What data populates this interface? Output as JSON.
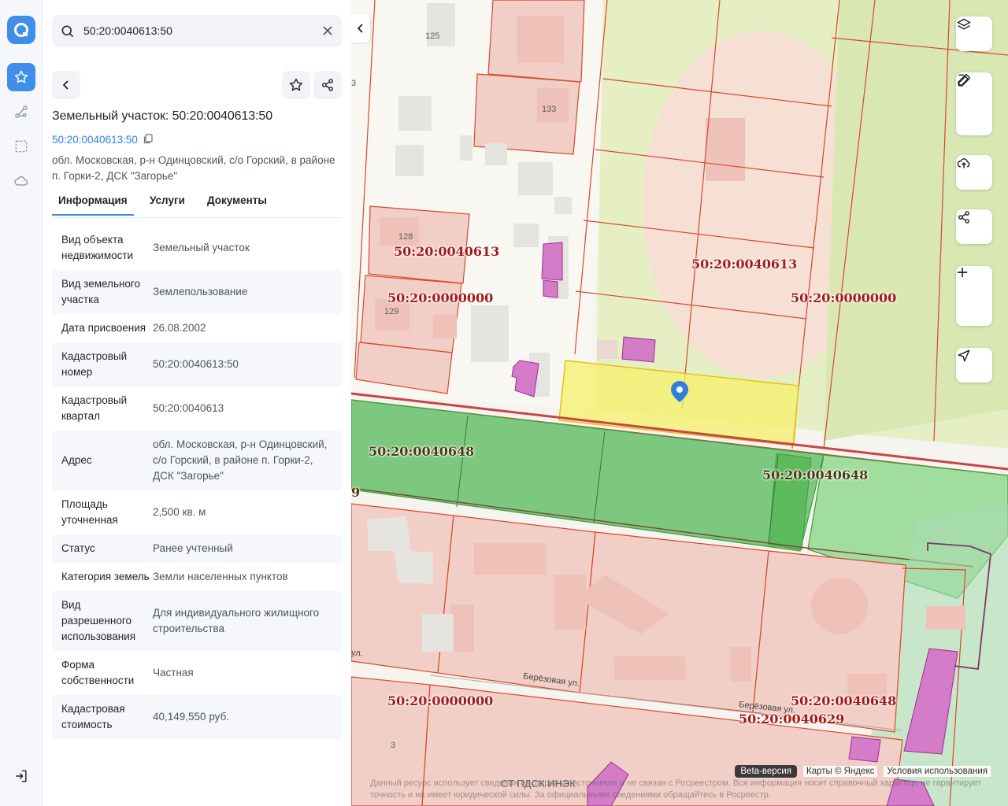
{
  "search": {
    "value": "50:20:0040613:50"
  },
  "panel": {
    "title": "Земельный участок: 50:20:0040613:50",
    "cad_link": "50:20:0040613:50",
    "address": "обл. Московская, р-н Одинцовский, с/о Горский, в районе п. Горки-2, ДСК \"Загорье\""
  },
  "tabs": [
    {
      "label": "Информация"
    },
    {
      "label": "Услуги"
    },
    {
      "label": "Документы"
    }
  ],
  "info": [
    {
      "k": "Вид объекта недвижимости",
      "v": "Земельный участок"
    },
    {
      "k": "Вид земельного участка",
      "v": "Землепользование"
    },
    {
      "k": "Дата присвоения",
      "v": "26.08.2002"
    },
    {
      "k": "Кадастровый номер",
      "v": "50:20:0040613:50"
    },
    {
      "k": "Кадастровый квартал",
      "v": "50:20:0040613"
    },
    {
      "k": "Адрес",
      "v": "обл. Московская, р-н Одинцовский, с/о Горский, в районе п. Горки-2, ДСК \"Загорье\""
    },
    {
      "k": "Площадь уточненная",
      "v": "2,500 кв. м"
    },
    {
      "k": "Статус",
      "v": "Ранее учтенный"
    },
    {
      "k": "Категория земель",
      "v": "Земли населенных пунктов"
    },
    {
      "k": "Вид разрешенного использования",
      "v": "Для индивидуального жилищного строительства"
    },
    {
      "k": "Форма собственности",
      "v": "Частная"
    },
    {
      "k": "Кадастровая стоимость",
      "v": "40,149,550 руб."
    }
  ],
  "map": {
    "labels": {
      "l1": "50:20:0040613",
      "l2": "50:20:0000000",
      "l3": "50:20:0040613",
      "l4": "50:20:0000000",
      "l5": "50:20:0040648",
      "l6": "50:20:0040648",
      "l7": "50:20:0000000",
      "l8": "50:20:0040648",
      "l9": "50:20:0040629",
      "l10": "9"
    },
    "houses": {
      "h125": "125",
      "h133": "133",
      "h128": "128",
      "h129": "129",
      "h3a": "3",
      "h3b": "3"
    },
    "streets": {
      "s1": "Берёзовая ул.",
      "s2": "Берёзовая ул.",
      "s3": "ул.",
      "s4": "СТ ПДСК ИНЭК"
    },
    "beta": "Beta-версия",
    "attribution": "Карты © Яндекс",
    "terms": "Условия использования",
    "disclaimer": "Данный ресурс использует сведения из открытых источников и не связан с Росреестром. Вся информация носит справочный характер, не гарантирует точность и не имеет юридической силы. За официальными сведениями обращайтесь в Росреестр."
  },
  "colors": {
    "accent": "#3f8fe8",
    "parcel_line": "#d9472b",
    "selected": "#f5f06a",
    "green_zone": "#5dbb5d"
  }
}
